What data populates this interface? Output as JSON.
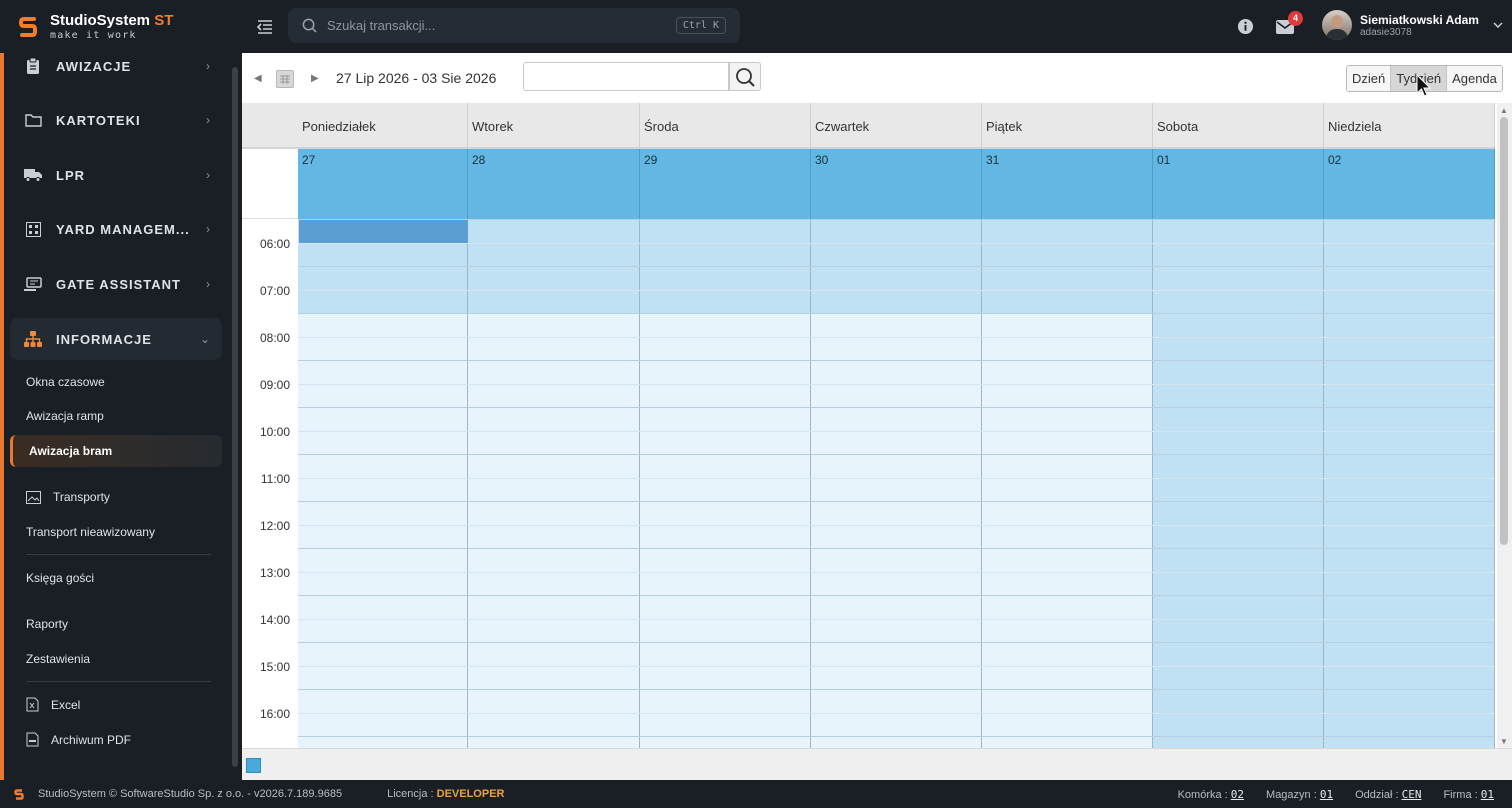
{
  "header": {
    "brand_name": "StudioSystem",
    "brand_suffix": "ST",
    "brand_tagline": "make it work",
    "search_placeholder": "Szukaj transakcji...",
    "search_shortcut": "Ctrl K",
    "notifications_count": "4",
    "user_name": "Siemiatkowski Adam",
    "user_login": "adasie3078"
  },
  "sidebar": {
    "groups": [
      {
        "label": "AWIZACJE",
        "icon": "clipboard-icon"
      },
      {
        "label": "KARTOTEKI",
        "icon": "folder-icon"
      },
      {
        "label": "LPR",
        "icon": "truck-icon"
      },
      {
        "label": "YARD MANAGEM...",
        "icon": "grid-icon"
      },
      {
        "label": "GATE ASSISTANT",
        "icon": "gate-icon"
      },
      {
        "label": "INFORMACJE",
        "icon": "sitemap-icon"
      }
    ],
    "items": [
      "Okna czasowe",
      "Awizacja ramp",
      "Awizacja bram",
      "Transporty",
      "Transport nieawizowany",
      "Księga gości",
      "Raporty",
      "Zestawienia",
      "Excel",
      "Archiwum PDF"
    ]
  },
  "calendar": {
    "date_range": "27 Lip 2026 - 03 Sie 2026",
    "views": [
      "Dzień",
      "Tydzień",
      "Agenda"
    ],
    "selected_view": "Tydzień",
    "days": [
      {
        "name": "Poniedziałek",
        "date": "27"
      },
      {
        "name": "Wtorek",
        "date": "28"
      },
      {
        "name": "Środa",
        "date": "29"
      },
      {
        "name": "Czwartek",
        "date": "30"
      },
      {
        "name": "Piątek",
        "date": "31"
      },
      {
        "name": "Sobota",
        "date": "01"
      },
      {
        "name": "Niedziela",
        "date": "02"
      }
    ],
    "hours": [
      "06:00",
      "07:00",
      "08:00",
      "09:00",
      "10:00",
      "11:00",
      "12:00",
      "13:00",
      "14:00",
      "15:00",
      "16:00"
    ],
    "colors": {
      "allday": "#62b8e2",
      "closed_slot": "#bfe1f3",
      "open_slot": "#e8f4fb",
      "weekend_slot": "#bfe1f3",
      "selected_slot": "#5b9fd2"
    }
  },
  "status": {
    "copyright": "StudioSystem © SoftwareStudio Sp. z o.o. - v2026.7.189.9685",
    "license_label": "Licencja :",
    "license_value": "DEVELOPER",
    "komorka_label": "Komórka :",
    "komorka_value": "02",
    "magazyn_label": "Magazyn :",
    "magazyn_value": "01",
    "oddzial_label": "Oddział :",
    "oddzial_value": "CEN",
    "firma_label": "Firma :",
    "firma_value": "01"
  }
}
